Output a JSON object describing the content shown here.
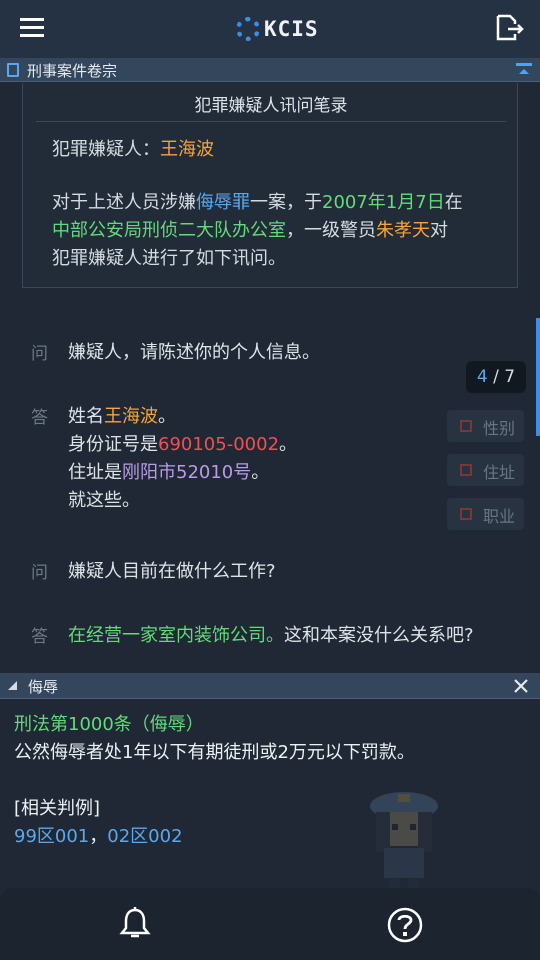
{
  "app": {
    "logo_text": "KCIS"
  },
  "section": {
    "title": "刑事案件卷宗"
  },
  "record": {
    "title": "犯罪嫌疑人讯问笔录",
    "suspect_label": "犯罪嫌疑人：",
    "suspect_name": "王海波",
    "para": {
      "p1": "对于上述人员涉嫌",
      "charge": "侮辱罪",
      "p2": "一案，于",
      "date": "2007年1月7日",
      "p3": "在",
      "location": "中部公安局刑侦二大队办公室",
      "p4": "，一级警员",
      "officer": "朱孝天",
      "p5": "对",
      "p6": "犯罪嫌疑人进行了如下讯问。"
    }
  },
  "qa_marks": {
    "question": "问",
    "answer": "答"
  },
  "qa": {
    "q1": "嫌疑人，请陈述你的个人信息。",
    "a1": {
      "name_prefix": "姓名",
      "name": "王海波",
      "name_suffix": "。",
      "id_prefix": "身份证号是",
      "id": "690105-0002",
      "id_suffix": "。",
      "addr_prefix": "住址是",
      "addr": "刚阳市52010号",
      "addr_suffix": "。",
      "end": "就这些。"
    },
    "q2": "嫌疑人目前在做什么工作?",
    "a2": {
      "highlight": "在经营一家室内装饰公司。",
      "rest": "这和本案没什么关系吧?"
    }
  },
  "pager": {
    "current": "4",
    "separator": " / ",
    "total": "7"
  },
  "tags": [
    "性别",
    "住址",
    "职业"
  ],
  "law": {
    "header": "侮辱",
    "title": "刑法第1000条（侮辱）",
    "body": "公然侮辱者处1年以下有期徒刑或2万元以下罚款。",
    "related_label": "[相关判例]",
    "related": [
      "99区001",
      "02区002"
    ],
    "related_sep": "，"
  },
  "colors": {
    "accent_blue": "#3b8fe8",
    "highlight_orange": "#f6a43a",
    "highlight_green": "#63db79",
    "highlight_red": "#ec5252",
    "highlight_purple": "#b89ce6"
  },
  "icons": {
    "menu": "menu-icon",
    "export": "export-doc-icon",
    "section": "document-icon",
    "collapse": "collapse-top-icon",
    "close": "close-icon",
    "bell": "bell-icon",
    "help": "help-icon"
  }
}
